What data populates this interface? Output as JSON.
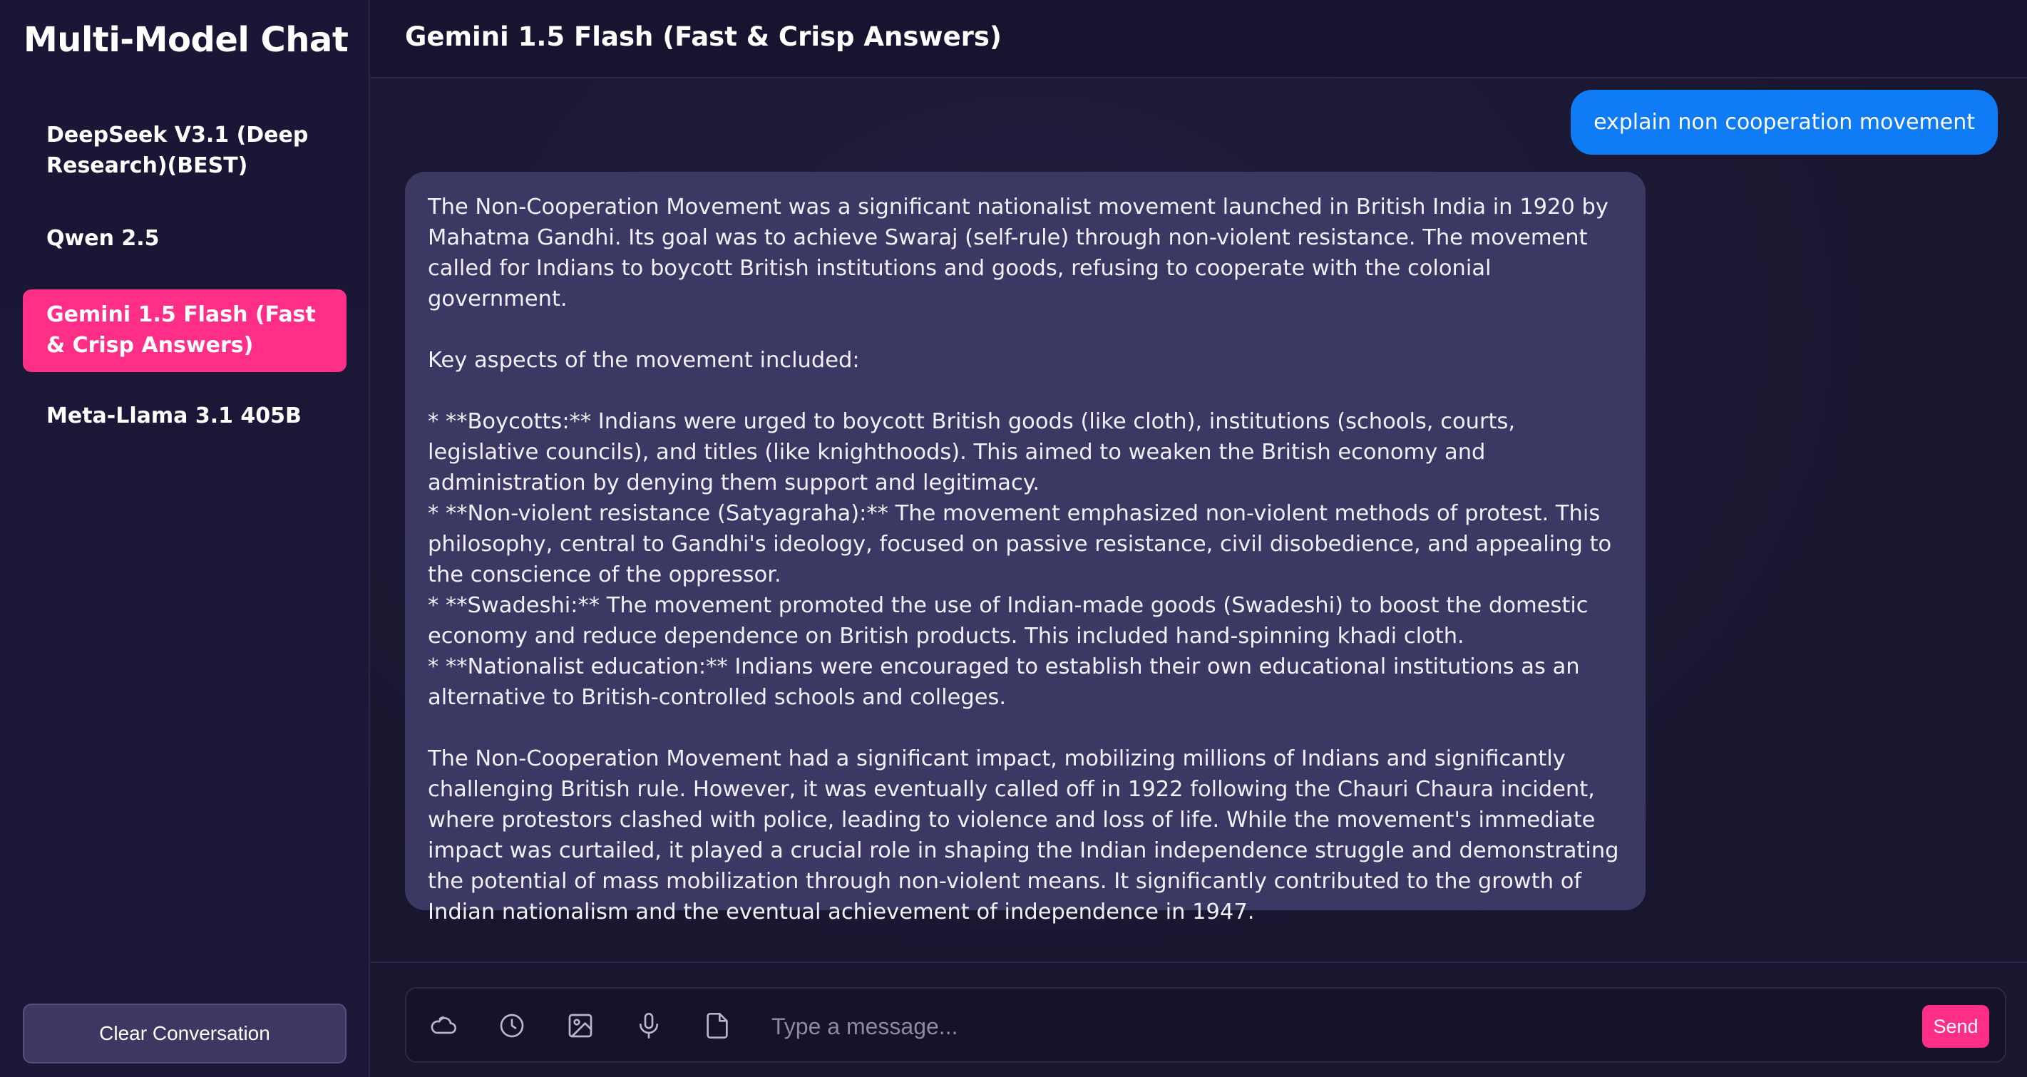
{
  "sidebar": {
    "title": "Multi-Model Chat",
    "models": [
      {
        "label": "DeepSeek V3.1 (Deep Research)(BEST)"
      },
      {
        "label": "Qwen 2.5"
      },
      {
        "label": "Gemini 1.5 Flash (Fast & Crisp Answers)",
        "active": true
      },
      {
        "label": "Meta-Llama 3.1 405B"
      }
    ],
    "clear_label": "Clear Conversation"
  },
  "header": {
    "title": "Gemini 1.5 Flash (Fast & Crisp Answers)"
  },
  "messages": {
    "user": "explain non cooperation movement",
    "assistant": {
      "p1": "The Non-Cooperation Movement was a significant nationalist movement launched in British India in 1920 by Mahatma Gandhi.  Its goal was to achieve Swaraj (self-rule) through non-violent resistance.  The movement called for Indians to boycott British institutions and goods, refusing to cooperate with the colonial government.",
      "p2": "Key aspects of the movement included:",
      "b1": "* **Boycotts:**  Indians were urged to boycott British goods (like cloth), institutions (schools, courts, legislative councils), and titles (like knighthoods).  This aimed to weaken the British economy and administration by denying them support and legitimacy.",
      "b2": "* **Non-violent resistance (Satyagraha):**  The movement emphasized non-violent methods of protest.  This philosophy, central to Gandhi's ideology, focused on passive resistance, civil disobedience, and appealing to the conscience of the oppressor.",
      "b3": "* **Swadeshi:**  The movement promoted the use of Indian-made goods (Swadeshi) to boost the domestic economy and reduce dependence on British products.  This included hand-spinning khadi cloth.",
      "b4": "* **Nationalist education:**  Indians were encouraged to establish their own educational institutions as an alternative to British-controlled schools and colleges.",
      "p3": "The Non-Cooperation Movement had a significant impact, mobilizing millions of Indians and significantly challenging British rule.  However, it was eventually called off in 1922 following the Chauri Chaura incident, where protestors clashed with police, leading to violence and loss of life.  While the movement's immediate impact was curtailed, it played a crucial role in shaping the Indian independence struggle and demonstrating the potential of mass mobilization through non-violent means.  It significantly contributed to the growth of Indian nationalism and the eventual achievement of independence in 1947."
    }
  },
  "composer": {
    "placeholder": "Type a message...",
    "send_label": "Send",
    "icons": [
      "weather-icon",
      "history-icon",
      "image-icon",
      "microphone-icon",
      "document-icon"
    ]
  },
  "colors": {
    "accent": "#ff2f87",
    "user_bubble": "#0f7cf5",
    "assistant_bubble": "#3b3864",
    "background": "#181530"
  }
}
